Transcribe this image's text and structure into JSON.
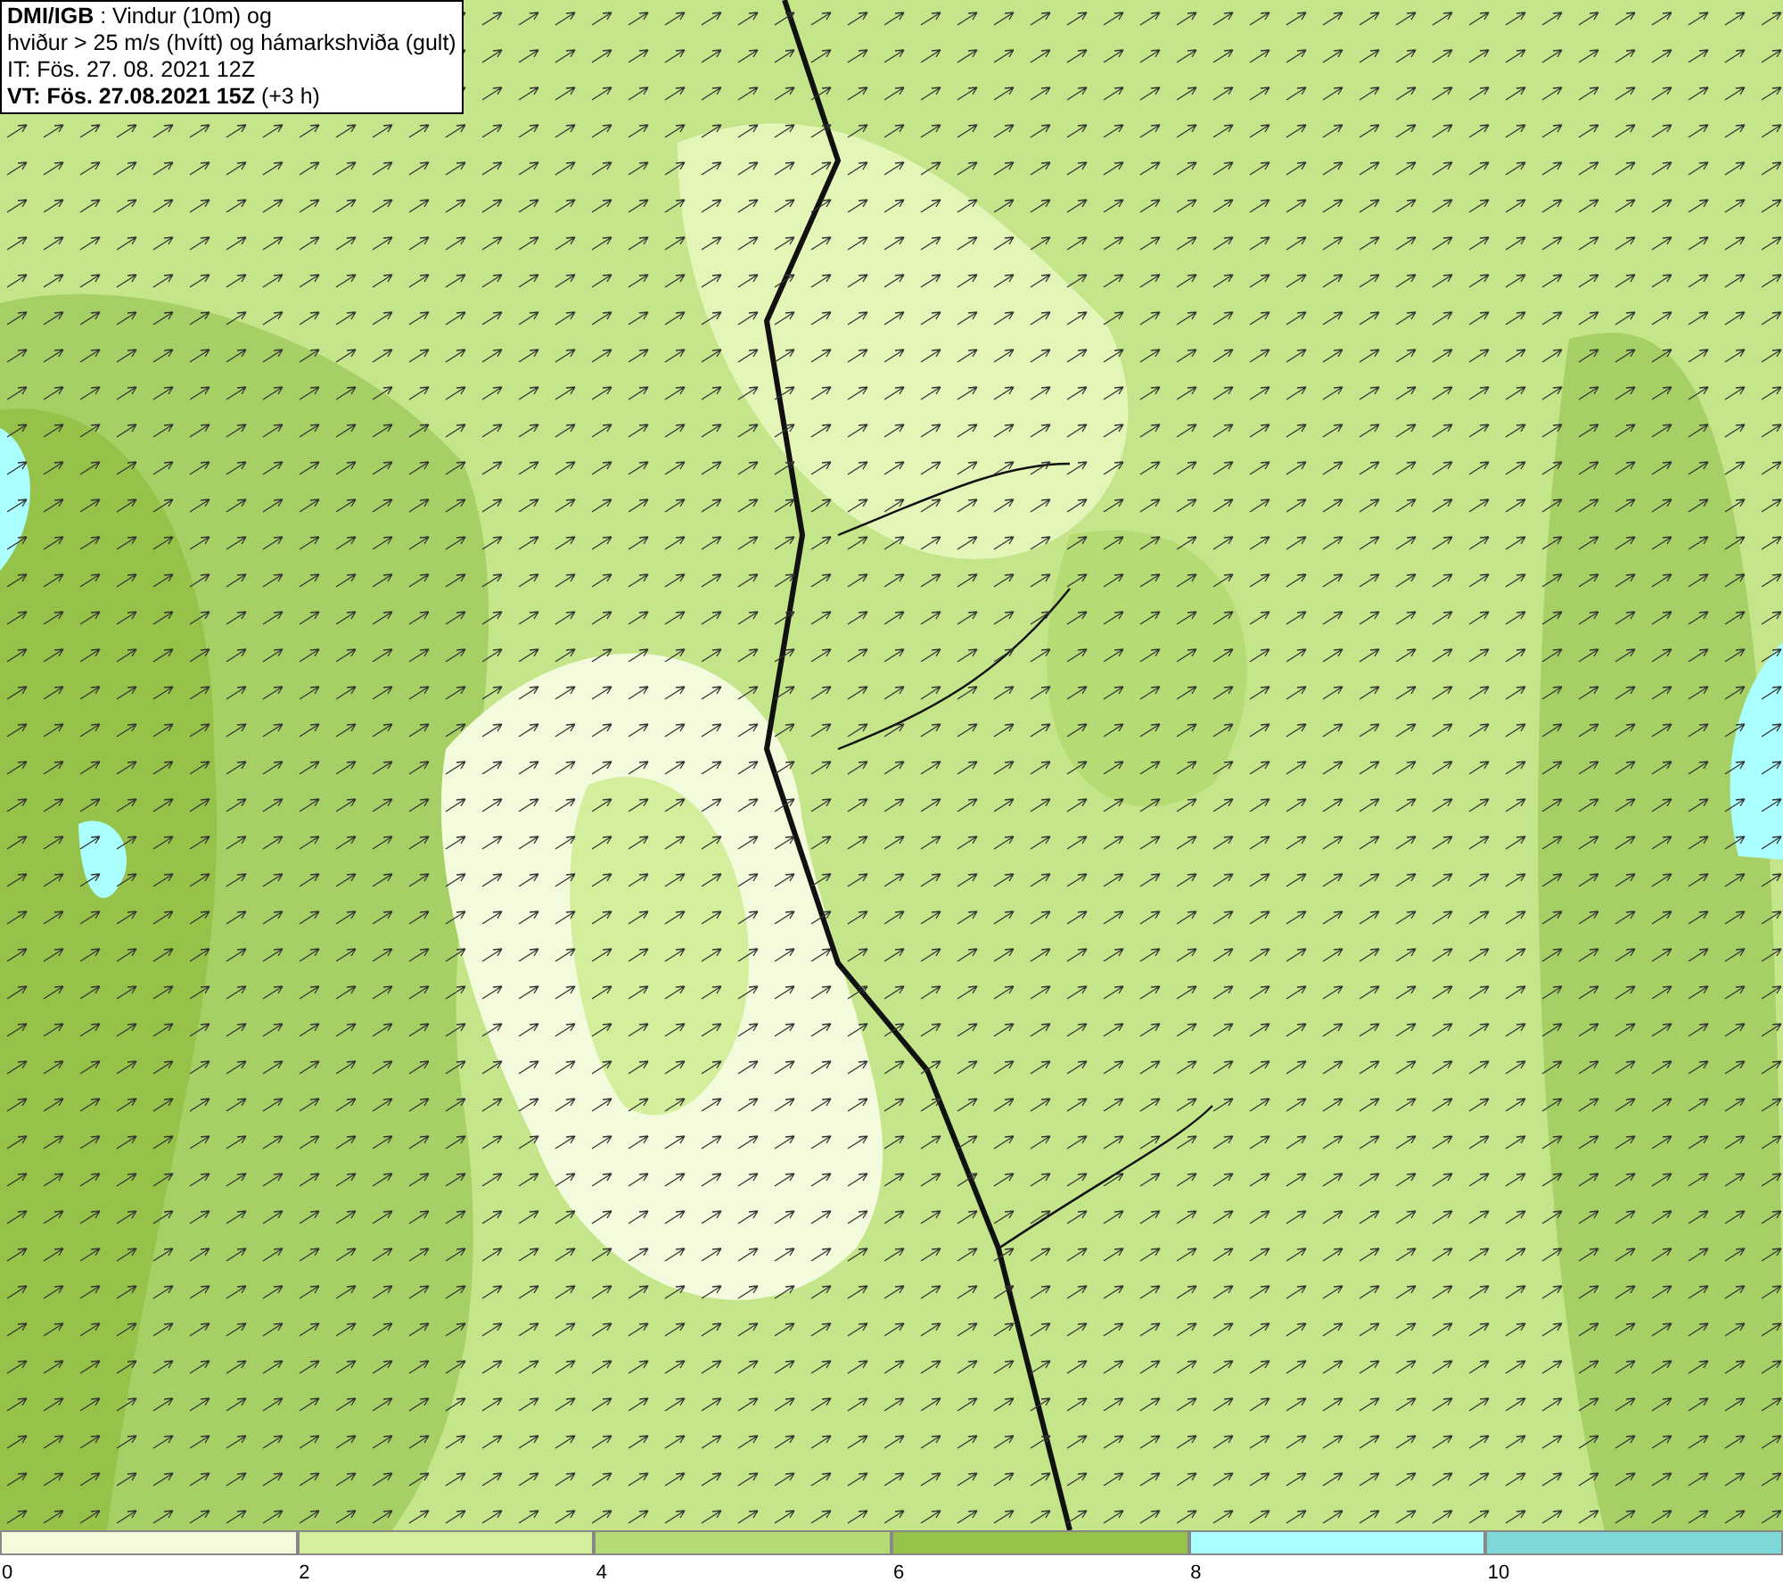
{
  "info_box": {
    "lines": [
      "**DMI/IGB** : Vindur (10m) og",
      "hviður > 25 m/s (hvítt) og hámarkshviða (gult)",
      "IT: Fös. 27. 08. 2021 12Z",
      "**VT: Fös. 27.08.2021 15Z** (+3 h)"
    ]
  },
  "legend": {
    "bins": [
      {
        "label": "0",
        "color": "#f4fbdc"
      },
      {
        "label": "2",
        "color": "#d4ef9c"
      },
      {
        "label": "4",
        "color": "#b5dc74"
      },
      {
        "label": "6",
        "color": "#97c24a"
      },
      {
        "label": "8",
        "color": "#aaffff"
      },
      {
        "label": "10",
        "color": "#7fd8d8"
      }
    ]
  }
}
